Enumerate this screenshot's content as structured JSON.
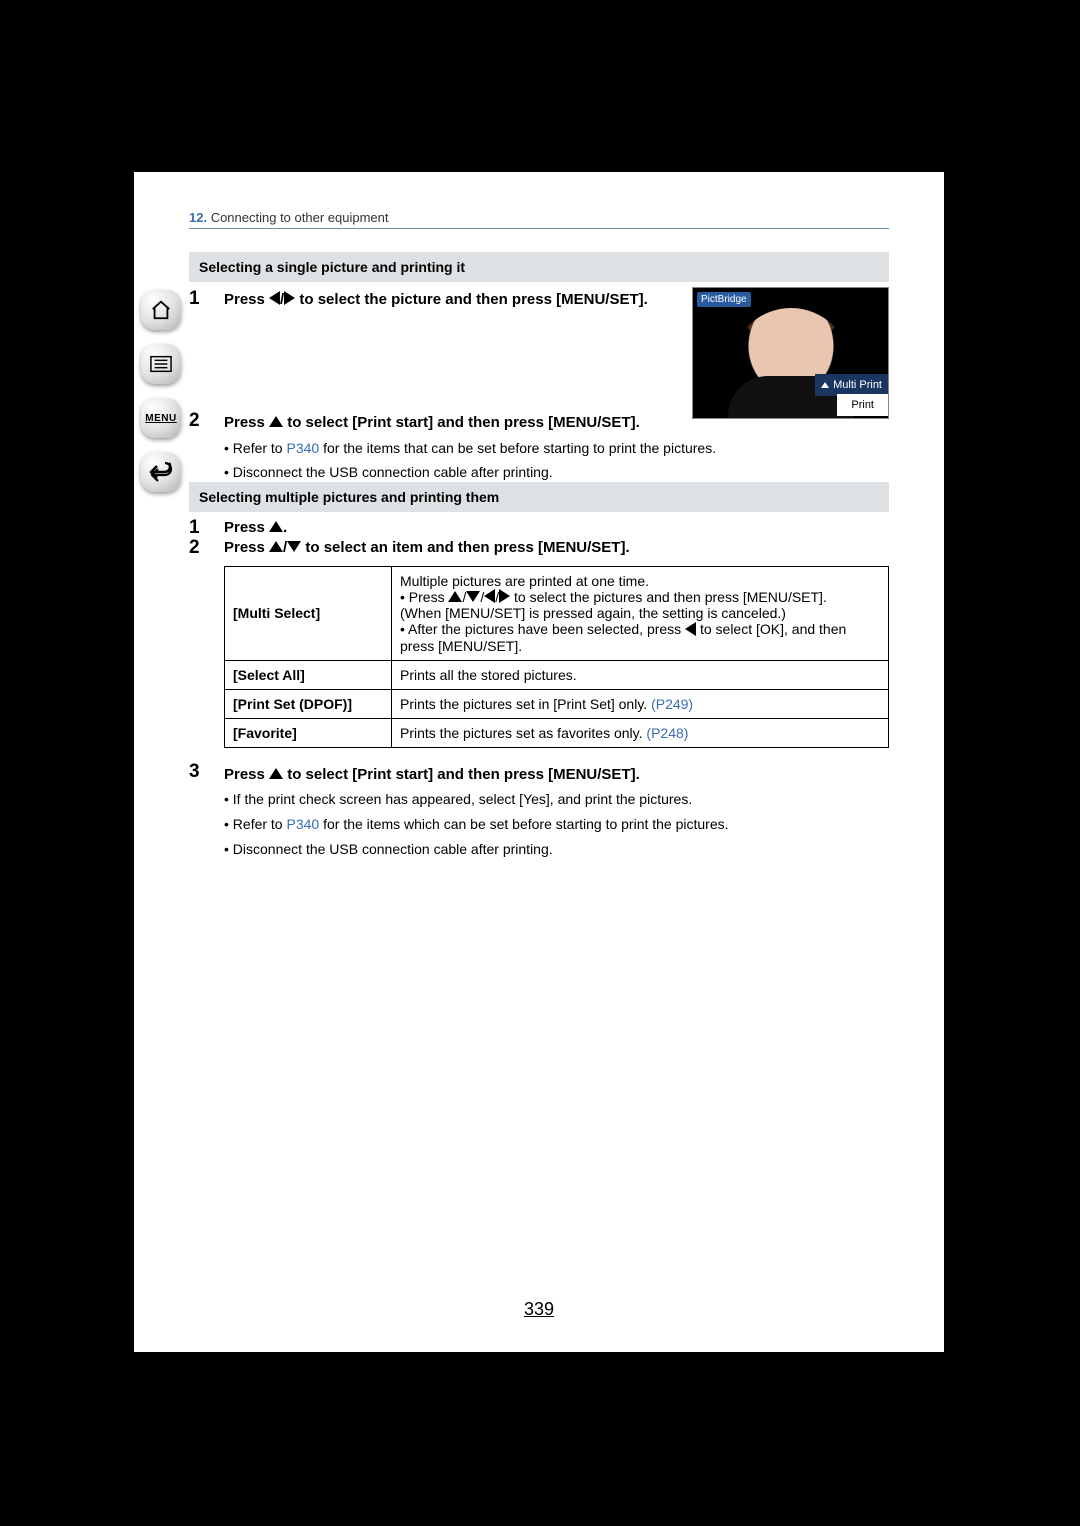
{
  "header": {
    "chapter_num": "12.",
    "chapter_title": " Connecting to other equipment"
  },
  "section1": {
    "title": "Selecting a single picture and printing it"
  },
  "s1_step1": {
    "num": "1",
    "text_a": "Press ",
    "text_b": " to select the picture and then press [MENU/SET]."
  },
  "screenshot": {
    "pictbridge": "PictBridge",
    "multi": "Multi Print",
    "print": "Print"
  },
  "s1_step2": {
    "num": "2",
    "title_a": "Press ",
    "title_b": " to select [Print start] and then press [MENU/SET].",
    "bullet1a": "Refer to ",
    "bullet1_link": "P340",
    "bullet1b": " for the items that can be set before starting to print the pictures.",
    "bullet2": "Disconnect the USB connection cable after printing."
  },
  "section2": {
    "title": "Selecting multiple pictures and printing them"
  },
  "s2_step1": {
    "num": "1",
    "text_a": "Press ",
    "text_b": "."
  },
  "s2_step2": {
    "num": "2",
    "text_a": "Press ",
    "text_b": " to select an item and then press [MENU/SET]."
  },
  "table": {
    "multi_select": {
      "label": "[Multi Select]",
      "l1": "Multiple pictures are printed at one time.",
      "l2a": "• Press ",
      "l2b": " to select the pictures and then press [MENU/SET].",
      "l3": "(When [MENU/SET] is pressed again, the setting is canceled.)",
      "l4a": "• After the pictures have been selected, press ",
      "l4b": " to select [OK], and then press [MENU/SET]."
    },
    "select_all": {
      "label": "[Select All]",
      "desc": "Prints all the stored pictures."
    },
    "dpof": {
      "label": "[Print Set (DPOF)]",
      "desc_a": "Prints the pictures set in [Print Set] only. ",
      "link": "(P249)"
    },
    "favorite": {
      "label": "[Favorite]",
      "desc_a": "Prints the pictures set as favorites only. ",
      "link": "(P248)"
    }
  },
  "s2_step3": {
    "num": "3",
    "title_a": "Press ",
    "title_b": " to select [Print start] and then press [MENU/SET].",
    "bullet1": "If the print check screen has appeared, select [Yes], and print the pictures.",
    "bullet2a": "Refer to ",
    "bullet2_link": "P340",
    "bullet2b": " for the items which can be set before starting to print the pictures.",
    "bullet3": "Disconnect the USB connection cable after printing."
  },
  "page_number": "339",
  "sidebar": {
    "menu": "MENU"
  }
}
